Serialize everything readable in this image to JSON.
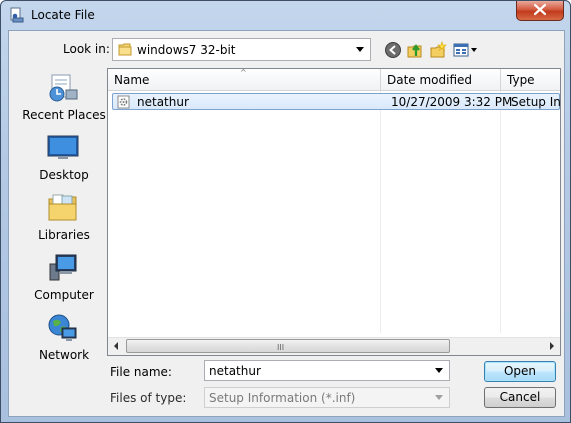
{
  "window": {
    "title": "Locate File"
  },
  "toolbar": {
    "look_in_label": "Look in:",
    "look_in_value": "windows7 32-bit",
    "icons": [
      "back-icon",
      "up-folder-icon",
      "new-folder-icon",
      "views-menu-icon"
    ]
  },
  "places": [
    {
      "label": "Recent Places",
      "icon": "recent-places-icon"
    },
    {
      "label": "Desktop",
      "icon": "desktop-icon"
    },
    {
      "label": "Libraries",
      "icon": "libraries-icon"
    },
    {
      "label": "Computer",
      "icon": "computer-icon"
    },
    {
      "label": "Network",
      "icon": "network-icon"
    }
  ],
  "filelist": {
    "columns": [
      "Name",
      "Date modified",
      "Type"
    ],
    "sort_indicator": "^",
    "rows": [
      {
        "name": "netathur",
        "date_modified": "10/27/2009 3:32 PM",
        "type": "Setup Infc",
        "selected": true
      }
    ],
    "scroll_grip": "III"
  },
  "form": {
    "file_name_label": "File name:",
    "file_name_value": "netathur",
    "files_of_type_label": "Files of type:",
    "files_of_type_value": "Setup Information (*.inf)"
  },
  "buttons": {
    "open": "Open",
    "cancel": "Cancel"
  },
  "colors": {
    "title_bar": "#b3c9e4",
    "close_button": "#c13a1c",
    "selection": "#d9e9fb",
    "dialog_bg": "#f0f0f0"
  }
}
